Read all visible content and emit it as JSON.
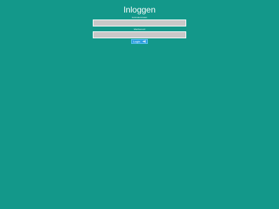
{
  "page": {
    "title": "Inloggen",
    "background_color": "#13988a"
  },
  "form": {
    "username": {
      "label": "Gebruikersnaam",
      "value": "",
      "placeholder": ""
    },
    "password": {
      "label": "Wachtwoord",
      "value": "",
      "placeholder": ""
    },
    "submit": {
      "label": "Login",
      "icon": "login-arrow-icon",
      "color": "#2c9ee0"
    }
  }
}
